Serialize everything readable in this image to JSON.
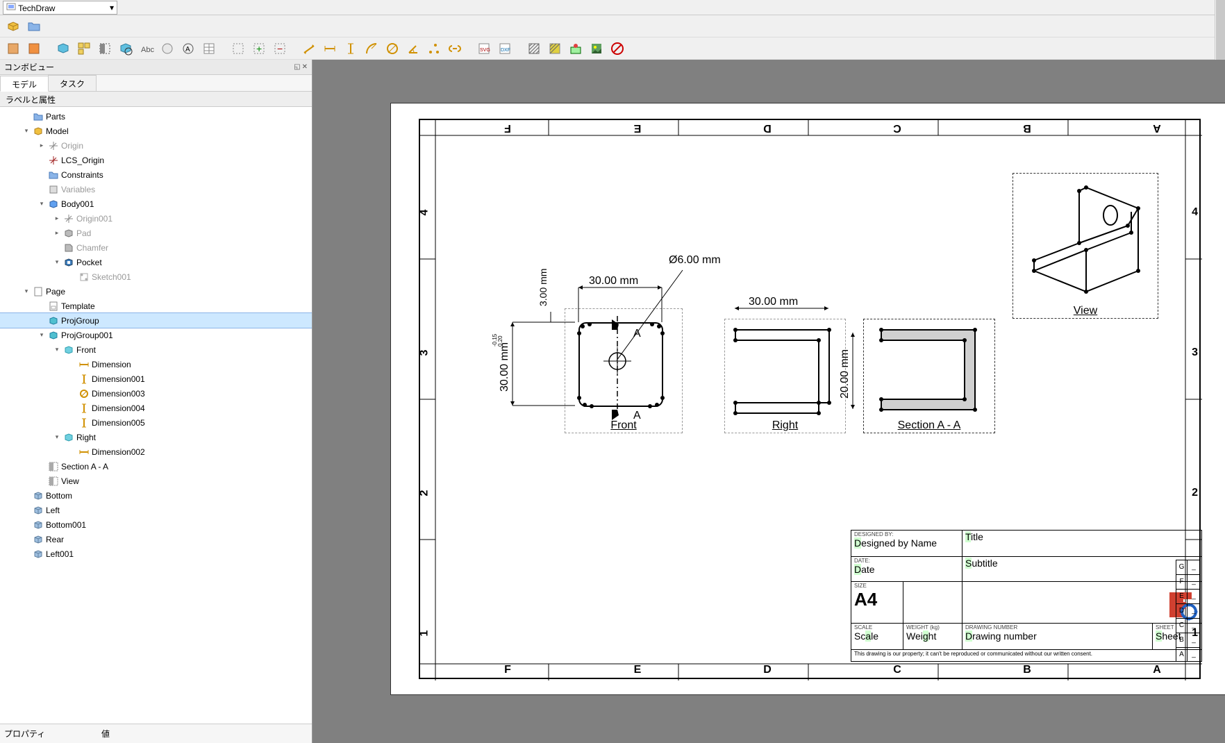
{
  "workbench_selector": "TechDraw",
  "panel_title": "コンボビュー",
  "tabs": {
    "model": "モデル",
    "task": "タスク"
  },
  "tree_header": "ラベルと属性",
  "tree": [
    {
      "lvl": 1,
      "exp": "",
      "icon": "folder",
      "label": "Parts"
    },
    {
      "lvl": 1,
      "exp": "▾",
      "icon": "model",
      "label": "Model"
    },
    {
      "lvl": 2,
      "exp": "▸",
      "icon": "axis",
      "label": "Origin",
      "grey": true
    },
    {
      "lvl": 2,
      "exp": "",
      "icon": "axis-r",
      "label": "LCS_Origin"
    },
    {
      "lvl": 2,
      "exp": "",
      "icon": "folder",
      "label": "Constraints"
    },
    {
      "lvl": 2,
      "exp": "",
      "icon": "var",
      "label": "Variables",
      "grey": true
    },
    {
      "lvl": 2,
      "exp": "▾",
      "icon": "body",
      "label": "Body001"
    },
    {
      "lvl": 3,
      "exp": "▸",
      "icon": "axis",
      "label": "Origin001",
      "grey": true
    },
    {
      "lvl": 3,
      "exp": "▸",
      "icon": "pad",
      "label": "Pad",
      "grey": true
    },
    {
      "lvl": 3,
      "exp": "",
      "icon": "chamfer",
      "label": "Chamfer",
      "grey": true
    },
    {
      "lvl": 3,
      "exp": "▾",
      "icon": "pocket",
      "label": "Pocket"
    },
    {
      "lvl": 4,
      "exp": "",
      "icon": "sketch",
      "label": "Sketch001",
      "grey": true
    },
    {
      "lvl": 1,
      "exp": "▾",
      "icon": "page",
      "label": "Page"
    },
    {
      "lvl": 2,
      "exp": "",
      "icon": "tmpl",
      "label": "Template"
    },
    {
      "lvl": 2,
      "exp": "",
      "icon": "projgrp",
      "label": "ProjGroup",
      "sel": true
    },
    {
      "lvl": 2,
      "exp": "▾",
      "icon": "projgrp",
      "label": "ProjGroup001"
    },
    {
      "lvl": 3,
      "exp": "▾",
      "icon": "view",
      "label": "Front"
    },
    {
      "lvl": 4,
      "exp": "",
      "icon": "dim-h",
      "label": "Dimension"
    },
    {
      "lvl": 4,
      "exp": "",
      "icon": "dim-v",
      "label": "Dimension001"
    },
    {
      "lvl": 4,
      "exp": "",
      "icon": "dim-d",
      "label": "Dimension003"
    },
    {
      "lvl": 4,
      "exp": "",
      "icon": "dim-v",
      "label": "Dimension004"
    },
    {
      "lvl": 4,
      "exp": "",
      "icon": "dim-v",
      "label": "Dimension005"
    },
    {
      "lvl": 3,
      "exp": "▾",
      "icon": "view",
      "label": "Right"
    },
    {
      "lvl": 4,
      "exp": "",
      "icon": "dim-h",
      "label": "Dimension002"
    },
    {
      "lvl": 2,
      "exp": "",
      "icon": "section",
      "label": "Section A - A"
    },
    {
      "lvl": 2,
      "exp": "",
      "icon": "section",
      "label": "View"
    },
    {
      "lvl": 1,
      "exp": "",
      "icon": "cube",
      "label": "Bottom"
    },
    {
      "lvl": 1,
      "exp": "",
      "icon": "cube",
      "label": "Left"
    },
    {
      "lvl": 1,
      "exp": "",
      "icon": "cube",
      "label": "Bottom001"
    },
    {
      "lvl": 1,
      "exp": "",
      "icon": "cube",
      "label": "Rear"
    },
    {
      "lvl": 1,
      "exp": "",
      "icon": "cube",
      "label": "Left001"
    }
  ],
  "prop_header": {
    "property": "プロパティ",
    "value": "値"
  },
  "drawing": {
    "cols_top": [
      "F",
      "E",
      "D",
      "C",
      "B",
      "A"
    ],
    "cols_bottom": [
      "F",
      "E",
      "D",
      "C",
      "B",
      "A"
    ],
    "rows_left": [
      "4",
      "3",
      "2",
      "1"
    ],
    "rows_right": [
      "4",
      "3",
      "2",
      "1"
    ],
    "views": {
      "front": {
        "label": "Front",
        "dims": {
          "w": "30.00 mm",
          "h": "30.00 mm",
          "th": "3.00 mm",
          "dia": "Ø6.00 mm",
          "tol_pos": "0.20",
          "tol_neg": "-0.15",
          "sec_sym": "A"
        }
      },
      "right": {
        "label": "Right",
        "dims": {
          "w": "30.00 mm",
          "h": "20.00 mm"
        }
      },
      "section": {
        "label": "Section A - A"
      },
      "iso": {
        "label": "View"
      }
    },
    "title_block": {
      "designed_by_label": "DESIGNED BY:",
      "designed_by": "Designed by Name",
      "date_label": "DATE:",
      "date": "Date",
      "size_label": "SIZE",
      "size": "A4",
      "title_label": "Title",
      "title": "Title",
      "subtitle": "Subtitle",
      "scale_label": "SCALE",
      "scale": "Scale",
      "weight_label": "WEIGHT (kg)",
      "weight": "Weight",
      "dn_label": "DRAWING NUMBER",
      "dn": "Drawing number",
      "sheet_label": "SHEET",
      "sheet": "Sheet",
      "footer": "This drawing is our property; it can't be reproduced or communicated without our written consent."
    },
    "side_index": [
      "G",
      "F",
      "E",
      "D",
      "C",
      "B",
      "A"
    ]
  }
}
